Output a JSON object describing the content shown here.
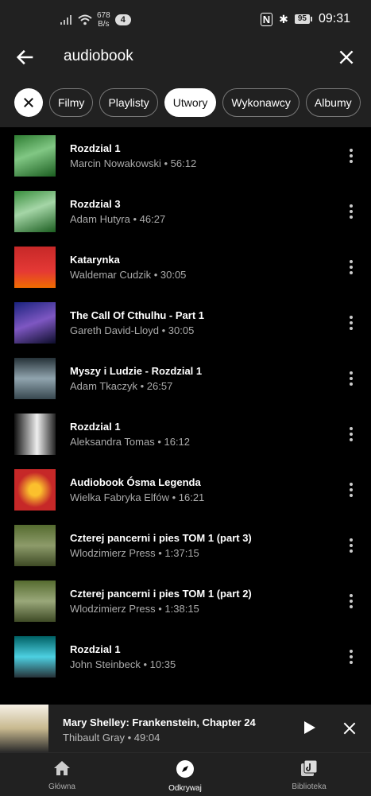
{
  "status_bar": {
    "net_speed": "678",
    "net_unit": "B/s",
    "notif_count": "4",
    "battery": "95",
    "time": "09:31"
  },
  "search": {
    "query": "audiobook"
  },
  "chips": [
    {
      "label": "Filmy",
      "active": false
    },
    {
      "label": "Playlisty",
      "active": false
    },
    {
      "label": "Utwory",
      "active": true
    },
    {
      "label": "Wykonawcy",
      "active": false
    },
    {
      "label": "Albumy",
      "active": false
    }
  ],
  "songs": [
    {
      "title": "Rozdzial 1",
      "subtitle": "Marcin Nowakowski • 56:12"
    },
    {
      "title": "Rozdzial 3",
      "subtitle": "Adam Hutyra • 46:27"
    },
    {
      "title": "Katarynka",
      "subtitle": "Waldemar Cudzik • 30:05"
    },
    {
      "title": "The Call Of Cthulhu - Part 1",
      "subtitle": "Gareth David-Lloyd • 30:05"
    },
    {
      "title": "Myszy i Ludzie - Rozdzial 1",
      "subtitle": "Adam Tkaczyk • 26:57"
    },
    {
      "title": "Rozdzial 1",
      "subtitle": "Aleksandra Tomas • 16:12"
    },
    {
      "title": "Audiobook Ósma Legenda",
      "subtitle": "Wielka Fabryka Elfów • 16:21"
    },
    {
      "title": "Czterej pancerni i pies TOM 1 (part 3)",
      "subtitle": "Wlodzimierz Press • 1:37:15"
    },
    {
      "title": "Czterej pancerni i pies TOM 1 (part 2)",
      "subtitle": "Wlodzimierz Press • 1:38:15"
    },
    {
      "title": "Rozdzial 1",
      "subtitle": "John Steinbeck • 10:35"
    }
  ],
  "player": {
    "title": "Mary Shelley: Frankenstein, Chapter 24",
    "subtitle": "Thibault Gray • 49:04"
  },
  "nav": [
    {
      "label": "Główna",
      "icon": "home-icon"
    },
    {
      "label": "Odkrywaj",
      "icon": "compass-icon",
      "active": true
    },
    {
      "label": "Biblioteka",
      "icon": "library-icon"
    }
  ]
}
